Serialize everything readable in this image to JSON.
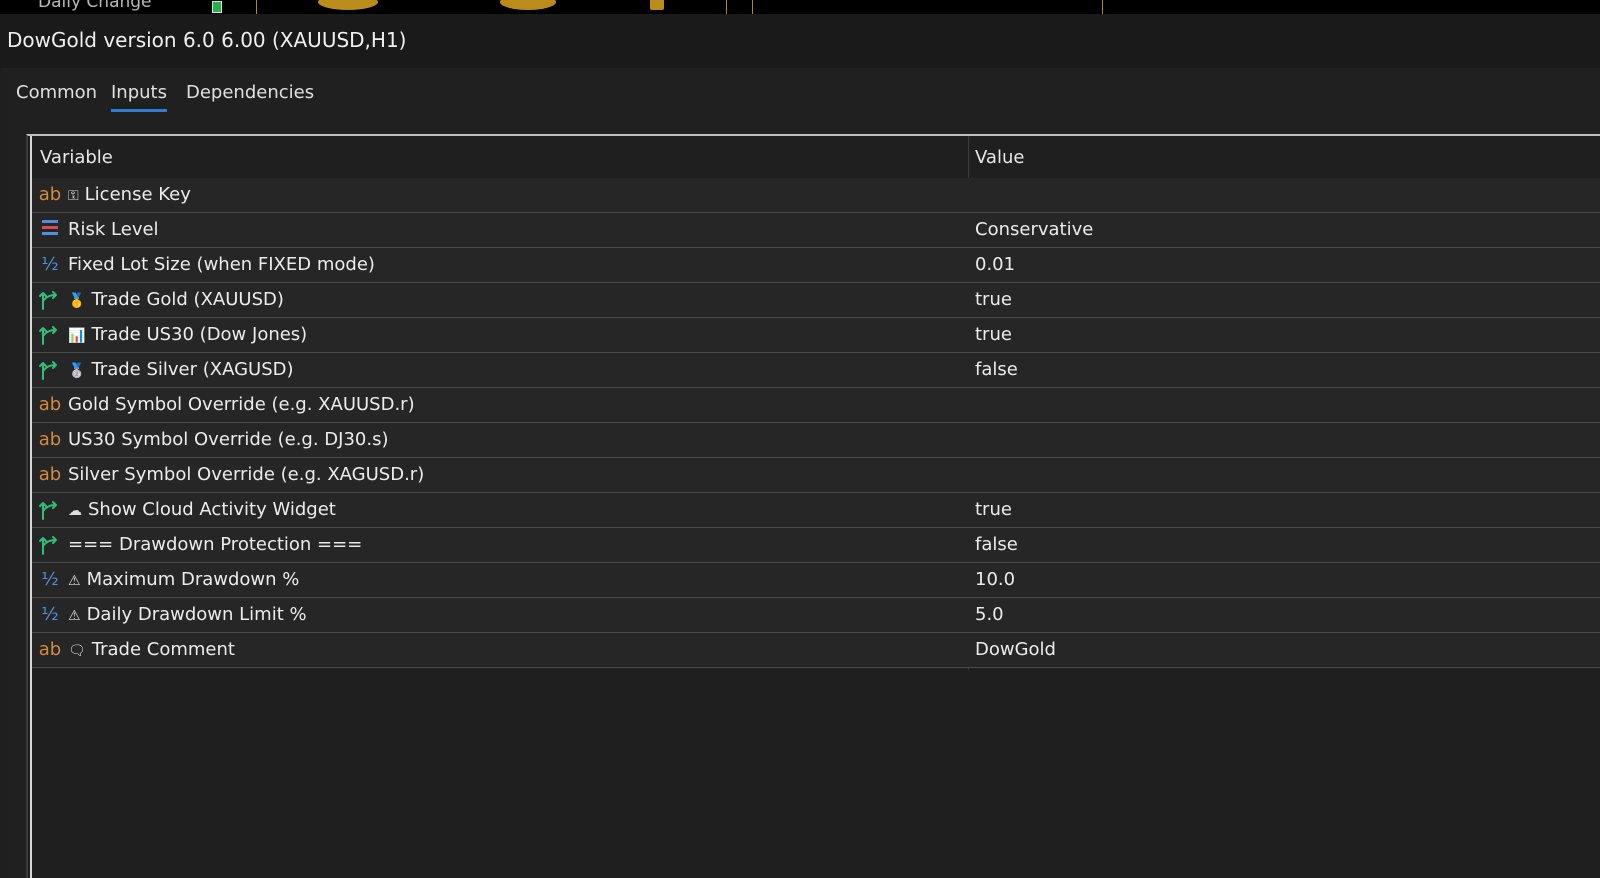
{
  "background": {
    "label": "Daily Change"
  },
  "window": {
    "title": "DowGold version 6.0 6.00 (XAUUSD,H1)"
  },
  "tabs": [
    {
      "label": "Common",
      "active": false
    },
    {
      "label": "Inputs",
      "active": true
    },
    {
      "label": "Dependencies",
      "active": false
    }
  ],
  "grid": {
    "columns": {
      "variable": "Variable",
      "value": "Value"
    },
    "rows": [
      {
        "type": "ab",
        "icon": "key-icon",
        "emoji": "⚿",
        "name": "License Key",
        "value": ""
      },
      {
        "type": "enum",
        "icon": "",
        "emoji": "",
        "name": "Risk Level",
        "value": "Conservative"
      },
      {
        "type": "frac",
        "icon": "",
        "emoji": "",
        "name": "Fixed Lot Size (when FIXED mode)",
        "value": "0.01"
      },
      {
        "type": "bool",
        "icon": "medal-icon",
        "emoji": "🥇",
        "name": "Trade Gold (XAUUSD)",
        "value": "true"
      },
      {
        "type": "bool",
        "icon": "chart-icon",
        "emoji": "📊",
        "name": "Trade US30 (Dow Jones)",
        "value": "true"
      },
      {
        "type": "bool",
        "icon": "medal-icon",
        "emoji": "🥈",
        "name": "Trade Silver (XAGUSD)",
        "value": "false"
      },
      {
        "type": "ab",
        "icon": "",
        "emoji": "",
        "name": "Gold Symbol Override (e.g. XAUUSD.r)",
        "value": ""
      },
      {
        "type": "ab",
        "icon": "",
        "emoji": "",
        "name": "US30 Symbol Override (e.g. DJ30.s)",
        "value": ""
      },
      {
        "type": "ab",
        "icon": "",
        "emoji": "",
        "name": "Silver Symbol Override (e.g. XAGUSD.r)",
        "value": ""
      },
      {
        "type": "bool",
        "icon": "cloud-icon",
        "emoji": "☁",
        "name": "Show Cloud Activity Widget",
        "value": "true"
      },
      {
        "type": "bool",
        "icon": "",
        "emoji": "",
        "name": "=== Drawdown Protection ===",
        "value": "false"
      },
      {
        "type": "frac",
        "icon": "warning-icon",
        "emoji": "⚠",
        "name": "Maximum Drawdown %",
        "value": "10.0"
      },
      {
        "type": "frac",
        "icon": "warning-icon",
        "emoji": "⚠",
        "name": "Daily Drawdown Limit %",
        "value": "5.0"
      },
      {
        "type": "ab",
        "icon": "comment-icon",
        "emoji": "🗨",
        "name": "Trade Comment",
        "value": "DowGold"
      }
    ]
  },
  "colors": {
    "accent": "#2f7fd1",
    "string_type": "#d48a3c",
    "number_type": "#4f8fe0",
    "bool_type": "#2fbf7a",
    "enum_type": "#d84d4d"
  }
}
